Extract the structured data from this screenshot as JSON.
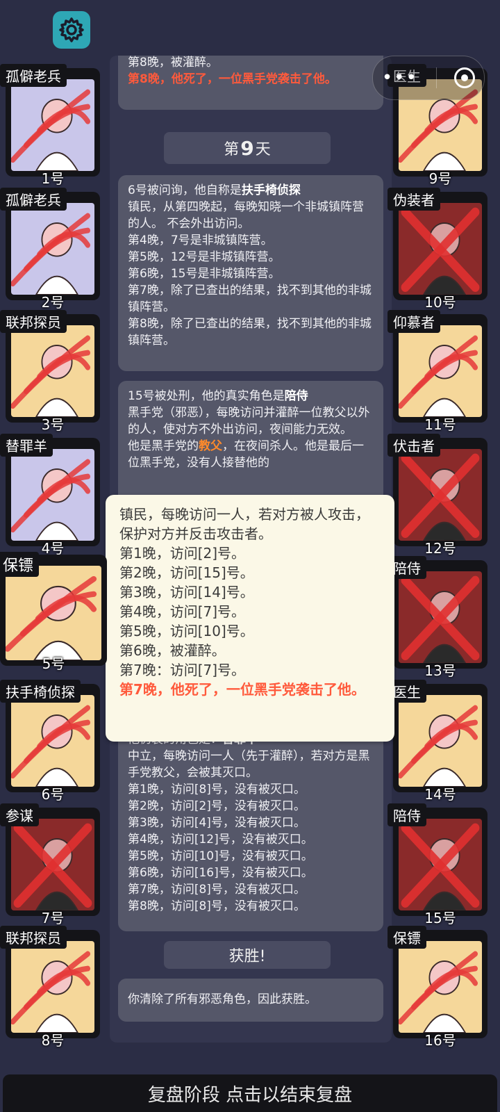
{
  "settings_icon": "gear-icon",
  "capsule": {
    "dots": "•••",
    "icons": [
      "more-icon",
      "close-target-icon"
    ]
  },
  "colors": {
    "background": "#2b2d45",
    "card": "#555769",
    "highlight_red": "#ff5a3c",
    "popup_bg": "#fbf8e7",
    "settings_teal": "#2ea7b5"
  },
  "log": {
    "top_card": {
      "line1": "第8晚，被灌醉。",
      "line2": "第8晚，他死了，一位黑手党袭击了他。"
    },
    "day_header": {
      "prefix": "第",
      "number": "9",
      "suffix": "天"
    },
    "card6": {
      "intro": "6号被问询，他自称是",
      "role": "扶手椅侦探",
      "lines": [
        "镇民，从第四晚起，每晚知晓一个非城镇阵营的人。 不会外出访问。",
        "第4晚，7号是非城镇阵营。",
        "第5晚，12号是非城镇阵营。",
        "第6晚，15号是非城镇阵营。",
        "第7晚，除了已查出的结果，找不到其他的非城镇阵营。",
        "第8晚，除了已查出的结果，找不到其他的非城镇阵营。"
      ]
    },
    "card15": {
      "intro": "15号被处刑，他的真实角色是",
      "role": "陪侍",
      "desc": "黑手党（邪恶），每晚访问并灌醉一位教父以外的人，使对方不外出访问，夜间能力无效。",
      "line_pre": "他是黑手党的",
      "role2": "教父",
      "line_post": "，在夜间杀人。他是最后一位黑手党，没有人接替他的"
    },
    "card_bottom": {
      "intro": "他伪装的角色是：",
      "role": "替罪羊",
      "lines": [
        "中立，每晚访问一人（先于灌醉），若对方是黑手党教父，会被其灭口。",
        "第1晚，访问[8]号，没有被灭口。",
        "第2晚，访问[2]号，没有被灭口。",
        "第3晚，访问[4]号，没有被灭口。",
        "第4晚，访问[12]号，没有被灭口。",
        "第5晚，访问[10]号，没有被灭口。",
        "第6晚，访问[16]号，没有被灭口。",
        "第7晚，访问[8]号，没有被灭口。",
        "第8晚，访问[8]号，没有被灭口。"
      ]
    },
    "victory_header": "获胜!",
    "victory_text": "你清除了所有邪恶角色，因此获胜。"
  },
  "popup": {
    "lines": [
      "镇民，每晚访问一人，若对方被人攻击，保护对方并反击攻击者。",
      "第1晚，访问[2]号。",
      "第2晚，访问[15]号。",
      "第3晚，访问[14]号。",
      "第4晚，访问[7]号。",
      "第5晚，访问[10]号。",
      "第6晚，被灌醉。",
      "第7晚：访问[7]号。"
    ],
    "death": "第7晚，他死了，一位黑手党袭击了他。"
  },
  "players_left": [
    {
      "role": "孤僻老兵",
      "number": "1号",
      "icon": "veteran-portrait",
      "bg": "#c9c6ea"
    },
    {
      "role": "孤僻老兵",
      "number": "2号",
      "icon": "veteran-portrait",
      "bg": "#c9c6ea"
    },
    {
      "role": "联邦探员",
      "number": "3号",
      "icon": "fbi-badge-portrait",
      "bg": "#f5d79a"
    },
    {
      "role": "替罪羊",
      "number": "4号",
      "icon": "scapegoat-portrait",
      "bg": "#c9c6ea"
    },
    {
      "role": "保镖",
      "number": "5号",
      "icon": "bodyguard-portrait",
      "bg": "#f5d79a"
    },
    {
      "role": "扶手椅侦探",
      "number": "6号",
      "icon": "armchair-portrait",
      "bg": "#f5d79a"
    },
    {
      "role": "参谋",
      "number": "7号",
      "icon": "advisor-portrait",
      "bg": "#8a2a2a"
    },
    {
      "role": "联邦探员",
      "number": "8号",
      "icon": "fbi-badge-portrait",
      "bg": "#f5d79a"
    }
  ],
  "players_right": [
    {
      "role": "医生",
      "number": "9号",
      "icon": "doctor-portrait",
      "bg": "#f5d79a"
    },
    {
      "role": "伪装者",
      "number": "10号",
      "icon": "disguiser-portrait",
      "bg": "#8a2a2a"
    },
    {
      "role": "仰慕者",
      "number": "11号",
      "icon": "admirer-portrait",
      "bg": "#f5d79a"
    },
    {
      "role": "伏击者",
      "number": "12号",
      "icon": "ambusher-portrait",
      "bg": "#8a2a2a"
    },
    {
      "role": "陪侍",
      "number": "13号",
      "icon": "escort-portrait",
      "bg": "#8a2a2a"
    },
    {
      "role": "医生",
      "number": "14号",
      "icon": "doctor-portrait",
      "bg": "#f5d79a"
    },
    {
      "role": "陪侍",
      "number": "15号",
      "icon": "escort-portrait",
      "bg": "#8a2a2a"
    },
    {
      "role": "保镖",
      "number": "16号",
      "icon": "bodyguard-portrait",
      "bg": "#f5d79a"
    }
  ],
  "bottom_bar": "复盘阶段 点击以结束复盘"
}
